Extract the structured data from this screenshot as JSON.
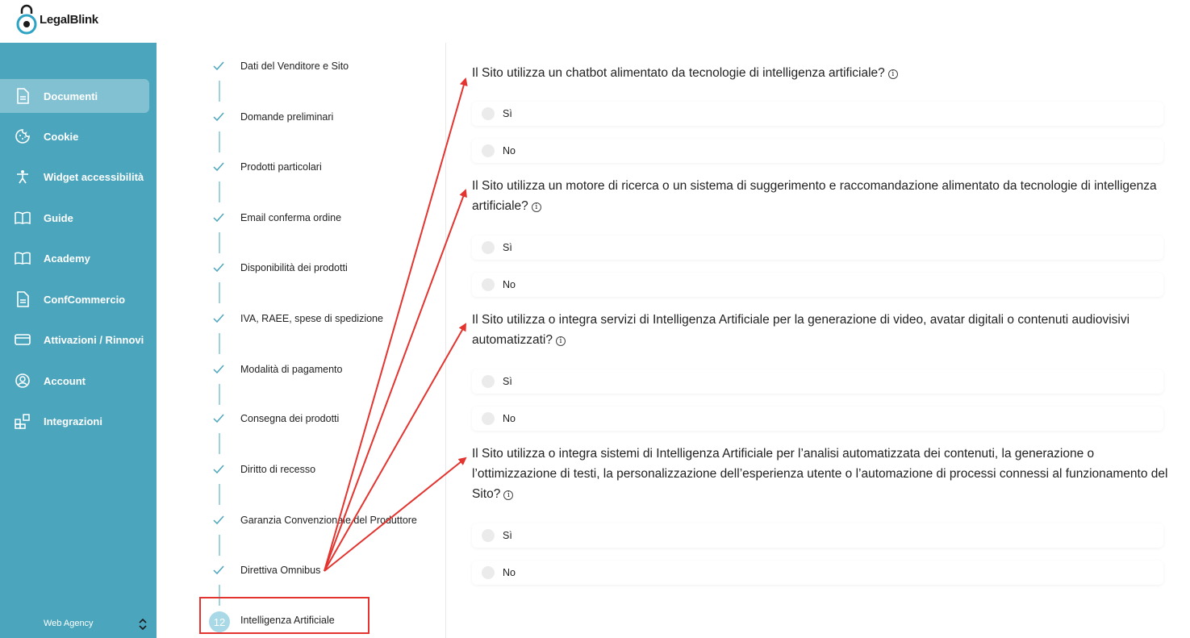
{
  "brand": {
    "name": "LegalBlink"
  },
  "sidebar": {
    "items": [
      {
        "label": "Documenti",
        "icon": "document-icon",
        "active": true
      },
      {
        "label": "Cookie",
        "icon": "cookie-icon",
        "active": false
      },
      {
        "label": "Widget accessibilità",
        "icon": "accessibility-icon",
        "active": false
      },
      {
        "label": "Guide",
        "icon": "book-icon",
        "active": false
      },
      {
        "label": "Academy",
        "icon": "book-icon",
        "active": false
      },
      {
        "label": "ConfCommercio",
        "icon": "document-icon",
        "active": false
      },
      {
        "label": "Attivazioni / Rinnovi",
        "icon": "credit-card-icon",
        "active": false
      },
      {
        "label": "Account",
        "icon": "user-icon",
        "active": false
      },
      {
        "label": "Integrazioni",
        "icon": "grid-plus-icon",
        "active": false
      }
    ],
    "account_type": "Web Agency"
  },
  "steps": {
    "completed": [
      "Dati del Venditore e Sito",
      "Domande preliminari",
      "Prodotti particolari",
      "Email conferma ordine",
      "Disponibilità dei prodotti",
      "IVA, RAEE, spese di spedizione",
      "Modalità di pagamento",
      "Consegna dei prodotti",
      "Diritto di recesso",
      "Garanzia Convenzionale del Produttore",
      "Direttiva Omnibus"
    ],
    "current": {
      "number": "12",
      "label": "Intelligenza Artificiale"
    }
  },
  "questions": [
    {
      "text": "Il Sito utilizza un chatbot alimentato da tecnologie di intelligenza artificiale?",
      "options": [
        "Sì",
        "No"
      ]
    },
    {
      "text": "Il Sito utilizza un motore di ricerca o un sistema di suggerimento e raccomandazione alimentato da tecnologie di intelligenza artificiale?",
      "options": [
        "Sì",
        "No"
      ]
    },
    {
      "text": "Il Sito utilizza o integra servizi di Intelligenza Artificiale per la generazione di video, avatar digitali o contenuti audiovisivi automatizzati?",
      "options": [
        "Sì",
        "No"
      ]
    },
    {
      "text": "Il Sito utilizza o integra sistemi di Intelligenza Artificiale per l’analisi automatizzata dei contenuti, la generazione o l’ottimizzazione di testi, la personalizzazione dell’esperienza utente o l’automazione di processi connessi al funzionamento del Sito?",
      "options": [
        "Sì",
        "No"
      ]
    }
  ],
  "info_glyph": "i",
  "colors": {
    "sidebar": "#4ba6bd",
    "accent": "#4ba6bd",
    "annotation": "#e3342f"
  }
}
